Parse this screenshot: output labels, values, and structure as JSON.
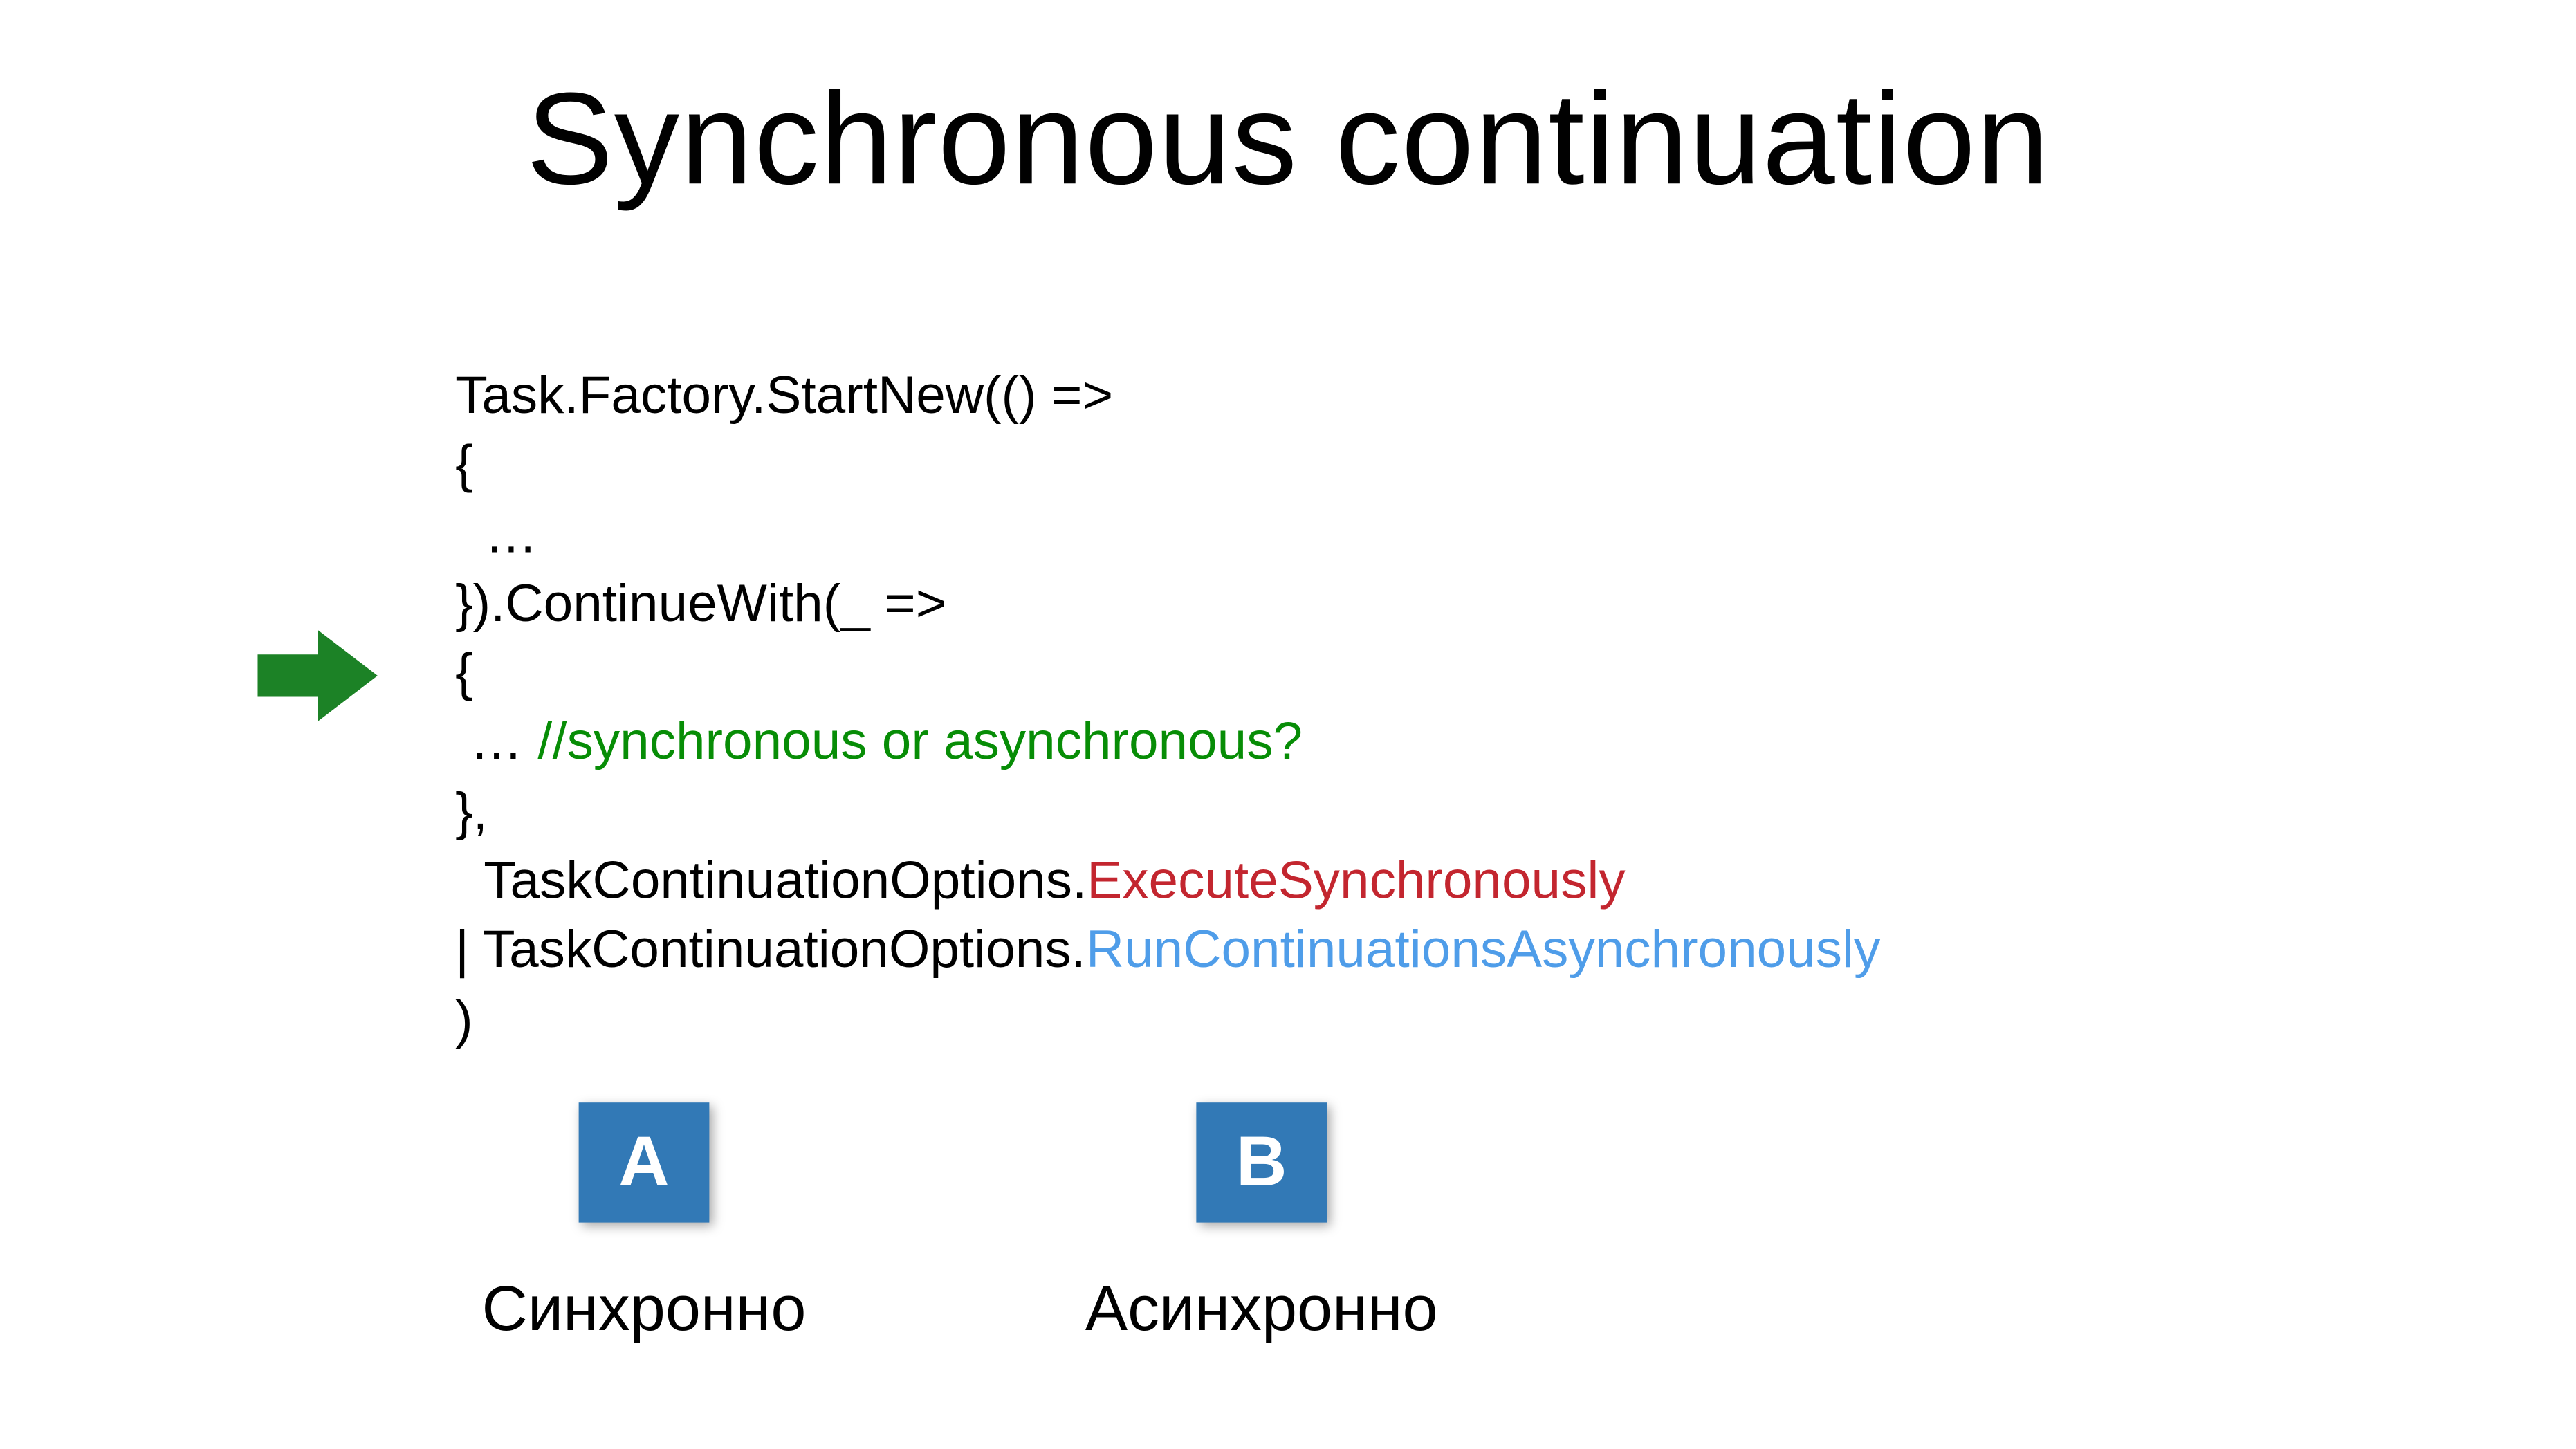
{
  "title": "Synchronous continuation",
  "code": {
    "l1": "Task.Factory.StartNew(() =>",
    "l2": "{",
    "l3": "  …",
    "l4": "}).ContinueWith(_ =>",
    "l5": "{",
    "l6a": " … ",
    "l6_comment": "//synchronous or asynchronous?",
    "l7": "},",
    "l8a": "  TaskContinuationOptions.",
    "l8b": "ExecuteSynchronously",
    "l9a": "| TaskContinuationOptions.",
    "l9b": "RunContinuationsAsynchronously",
    "l10": ")"
  },
  "answers": {
    "a": {
      "chip": "A",
      "label": "Синхронно"
    },
    "b": {
      "chip": "B",
      "label": "Асинхронно"
    }
  },
  "icons": {
    "arrow": "arrow-right-icon"
  },
  "colors": {
    "comment": "#078d06",
    "optA": "#c3262f",
    "optB": "#4f9de9",
    "chip_bg": "#3279b6"
  }
}
